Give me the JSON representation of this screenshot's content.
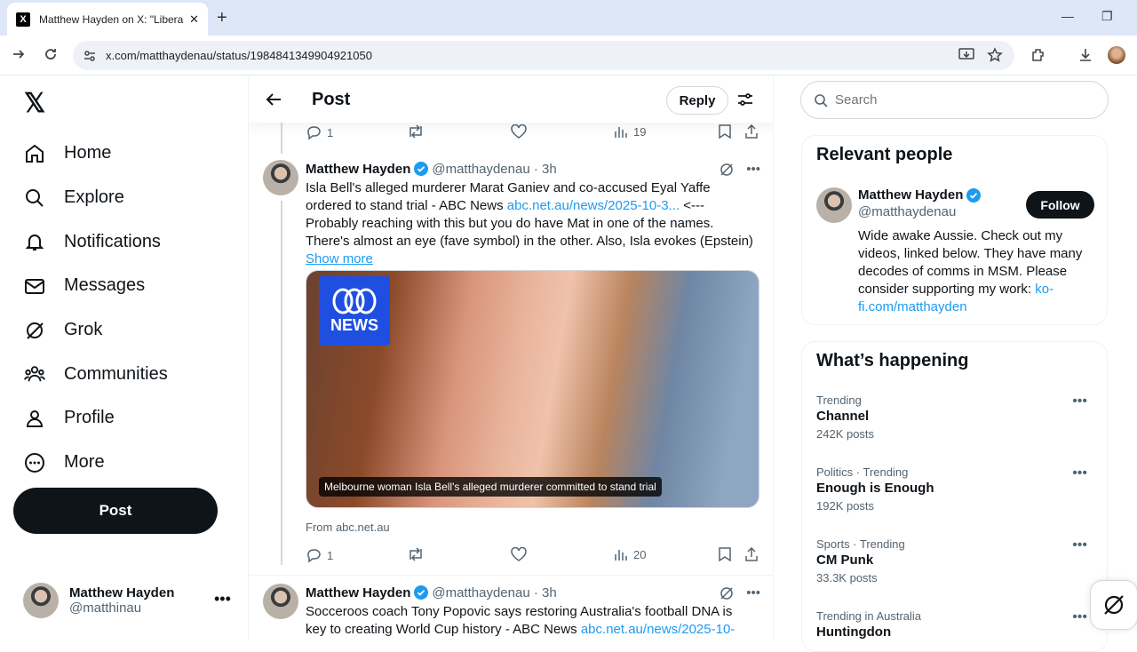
{
  "browser": {
    "tab_title": "Matthew Hayden on X: \"Liberal",
    "url": "x.com/matthaydenau/status/1984841349904921050"
  },
  "nav": {
    "items": [
      {
        "label": "Home",
        "icon": "home-icon"
      },
      {
        "label": "Explore",
        "icon": "search-icon"
      },
      {
        "label": "Notifications",
        "icon": "bell-icon"
      },
      {
        "label": "Messages",
        "icon": "mail-icon"
      },
      {
        "label": "Grok",
        "icon": "grok-icon"
      },
      {
        "label": "Communities",
        "icon": "communities-icon"
      },
      {
        "label": "Profile",
        "icon": "person-icon"
      },
      {
        "label": "More",
        "icon": "more-circle-icon"
      }
    ],
    "post_label": "Post"
  },
  "account": {
    "name": "Matthew Hayden",
    "handle": "@matthinau"
  },
  "header": {
    "title": "Post",
    "reply_label": "Reply"
  },
  "top_actions": {
    "replies": "1",
    "views": "19"
  },
  "tweet1": {
    "name": "Matthew Hayden",
    "handle": "@matthaydenau",
    "time": "· 3h",
    "line1": "Isla Bell's alleged murderer Marat Ganiev and co-accused Eyal Yaffe",
    "line2a": "ordered to stand trial - ABC News ",
    "line2link": "abc.net.au/news/2025-10-3...",
    "line2b": " <---",
    "line3": "Probably reaching with this but you do have Mat in one of the names.",
    "line4": "There's almost an eye (fave symbol) in the other. Also, Isla evokes (Epstein)",
    "show_more": "Show more",
    "media_caption": "Melbourne woman Isla Bell's alleged murderer committed to stand trial",
    "from": "From abc.net.au",
    "replies": "1",
    "views": "20"
  },
  "tweet2": {
    "name": "Matthew Hayden",
    "handle": "@matthaydenau",
    "time": "· 3h",
    "line1": "Socceroos coach Tony Popovic says restoring Australia's football DNA is",
    "line2a": "key to creating World Cup history - ABC News ",
    "line2link": "abc.net.au/news/2025-10-"
  },
  "search": {
    "placeholder": "Search"
  },
  "relevant": {
    "title": "Relevant people",
    "name": "Matthew Hayden",
    "handle": "@matthaydenau",
    "follow_label": "Follow",
    "bio": "Wide awake Aussie. Check out my videos, linked below. They have many decodes of comms in MSM. Please consider supporting my work: ",
    "bio_link": "ko-fi.com/matthayden"
  },
  "happening": {
    "title": "What’s happening",
    "trends": [
      {
        "meta": "Trending",
        "name": "Channel",
        "posts": "242K posts"
      },
      {
        "meta": "Politics · Trending",
        "name": "Enough is Enough",
        "posts": "192K posts"
      },
      {
        "meta": "Sports · Trending",
        "name": "CM Punk",
        "posts": "33.3K posts"
      },
      {
        "meta": "Trending in Australia",
        "name": "Huntingdon",
        "posts": ""
      }
    ]
  },
  "abc_logo": {
    "text": "NEWS"
  },
  "colors": {
    "accent": "#1d9bf0",
    "verified": "#1d9bf0",
    "dark": "#0f1419",
    "muted": "#536471"
  }
}
